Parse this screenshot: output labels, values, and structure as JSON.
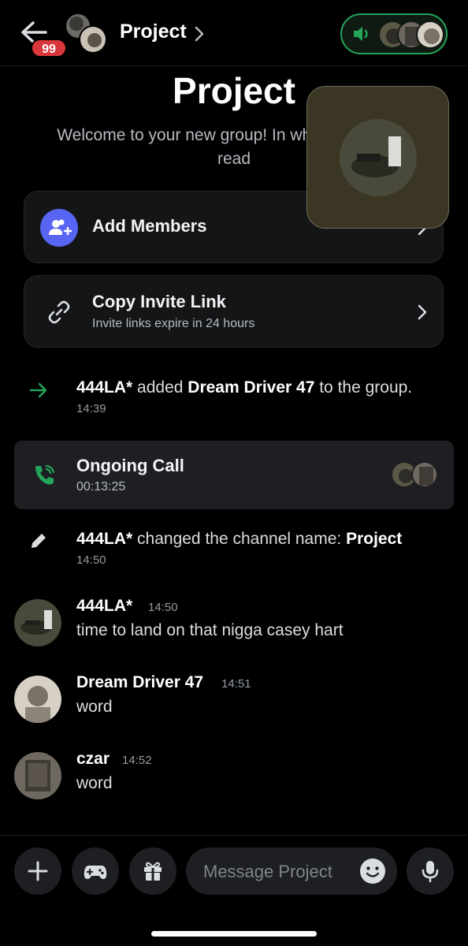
{
  "header": {
    "title": "Project",
    "unread_badge": "99",
    "back_icon": "arrow-left-icon",
    "chevron_icon": "chevron-right-icon"
  },
  "voice_status": {
    "icon": "speaker-icon",
    "accent": "#23a55a"
  },
  "welcome": {
    "title": "Project",
    "text": "Welcome to your new group! In                whenever you're read"
  },
  "actions": {
    "add_members": {
      "label": "Add Members",
      "icon": "add-user-icon"
    },
    "copy_invite": {
      "label": "Copy Invite Link",
      "sub": "Invite links expire in 24 hours",
      "icon": "link-icon"
    }
  },
  "events": {
    "added": {
      "actor": "444LA*",
      "verb": " added ",
      "target": "Dream Driver 47",
      "rest": " to the group.",
      "time": "14:39"
    },
    "call": {
      "title": "Ongoing Call",
      "duration": "00:13:25"
    },
    "rename": {
      "actor": "444LA*",
      "rest": " changed the channel name: ",
      "name": "Project",
      "time": "14:50"
    }
  },
  "messages": [
    {
      "author": "444LA*",
      "time": "14:50",
      "content": "time to land on that nigga casey hart"
    },
    {
      "author": "Dream Driver 47",
      "time": "14:51",
      "content": "word"
    },
    {
      "author": "czar",
      "time": "14:52",
      "content": "word"
    }
  ],
  "composer": {
    "placeholder": "Message Project",
    "buttons": [
      "plus-icon",
      "gamepad-icon",
      "gift-icon",
      "microphone-icon"
    ]
  },
  "colors": {
    "brand": "#5865f2",
    "online": "#23a55a",
    "badge": "#da373c"
  }
}
